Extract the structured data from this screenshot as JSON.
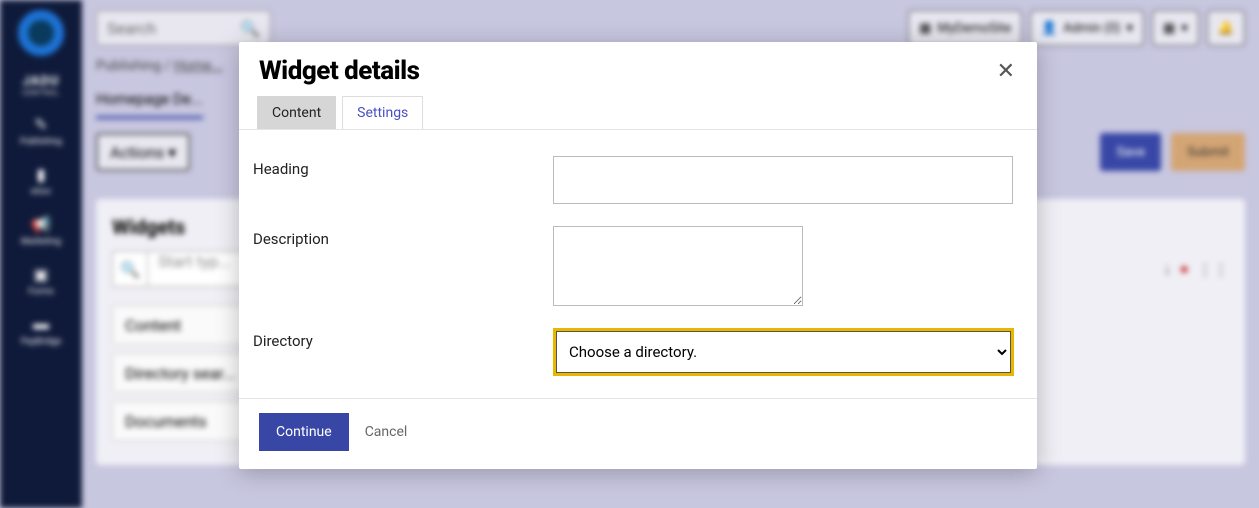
{
  "brand": {
    "name": "JADU",
    "sub": "CENTRAL"
  },
  "sidebar": {
    "items": [
      {
        "label": "Publishing"
      },
      {
        "label": "eGov"
      },
      {
        "label": "Marketing"
      },
      {
        "label": "Forms"
      },
      {
        "label": "PayBridge"
      }
    ]
  },
  "topbar": {
    "search_placeholder": "Search",
    "site_label": "MyDemoSite",
    "user_label": "Admin (0)"
  },
  "breadcrumb": {
    "root": "Publishing",
    "current": "Home..."
  },
  "page_tab": "Homepage De...",
  "toolbar": {
    "actions": "Actions",
    "save": "Save",
    "submit": "Submit"
  },
  "widgets": {
    "title": "Widgets",
    "search_placeholder": "Start typ...",
    "items": [
      "Content",
      "Directory sear...",
      "Documents"
    ]
  },
  "modal": {
    "title": "Widget details",
    "tabs": {
      "content": "Content",
      "settings": "Settings"
    },
    "fields": {
      "heading": {
        "label": "Heading",
        "value": ""
      },
      "description": {
        "label": "Description",
        "value": ""
      },
      "directory": {
        "label": "Directory",
        "placeholder": "Choose a directory."
      }
    },
    "continue": "Continue",
    "cancel": "Cancel"
  }
}
